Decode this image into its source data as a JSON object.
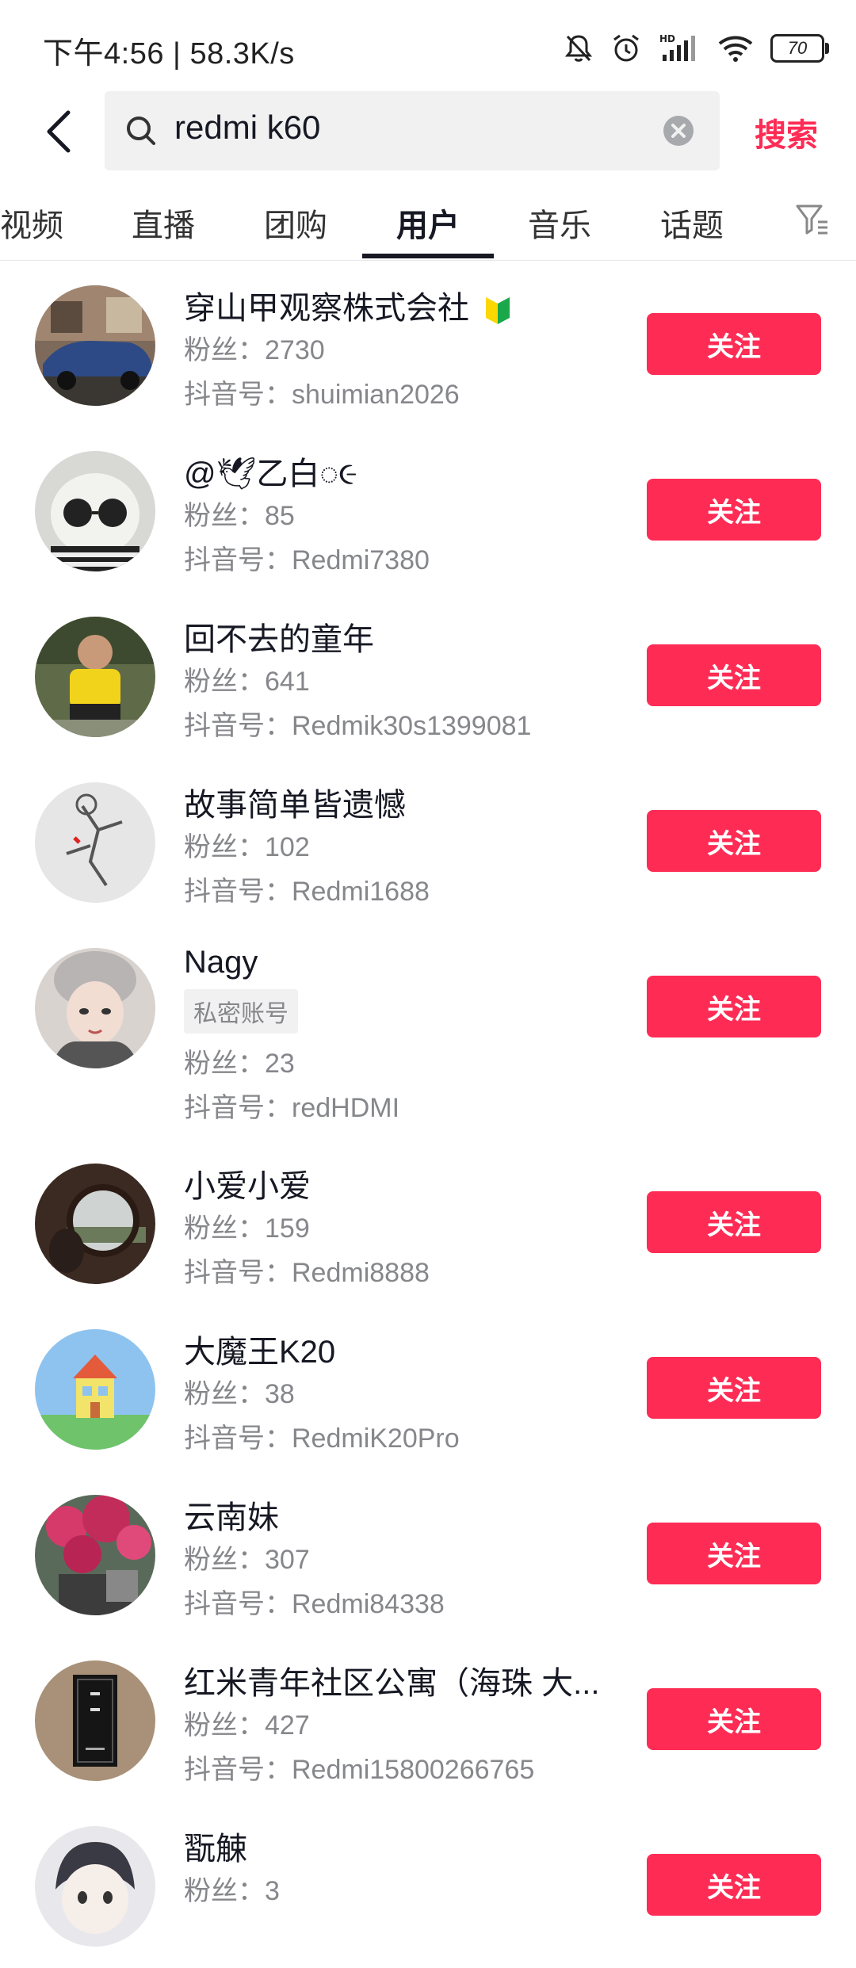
{
  "status_bar": {
    "time_speed": "下午4:56 | 58.3K/s",
    "battery": "70",
    "icons": [
      "mute-bell-icon",
      "alarm-icon",
      "hd-signal-icon",
      "wifi-icon",
      "battery-icon"
    ]
  },
  "search": {
    "query": "redmi k60",
    "submit_label": "搜索"
  },
  "tabs": [
    {
      "label": "视频"
    },
    {
      "label": "直播"
    },
    {
      "label": "团购"
    },
    {
      "label": "用户"
    },
    {
      "label": "音乐"
    },
    {
      "label": "话题"
    }
  ],
  "active_tab": "用户",
  "colors": {
    "accent": "#fe2c55",
    "text": "#161823",
    "secondary": "#86878b"
  },
  "users": [
    {
      "name": "穿山甲观察株式会社",
      "fans": "粉丝：2730",
      "douyin_id": "抖音号：shuimian2026",
      "follow": "关注"
    },
    {
      "name": "@🕊乙白◌૯",
      "fans": "粉丝：85",
      "douyin_id": "抖音号：Redmi7380",
      "follow": "关注"
    },
    {
      "name": "回不去的童年",
      "fans": "粉丝：641",
      "douyin_id": "抖音号：Redmik30s1399081",
      "follow": "关注"
    },
    {
      "name": "故事简单皆遗憾",
      "fans": "粉丝：102",
      "douyin_id": "抖音号：Redmi1688",
      "follow": "关注"
    },
    {
      "name": "Nagy",
      "tag": "私密账号",
      "fans": "粉丝：23",
      "douyin_id": "抖音号：redHDMI",
      "follow": "关注"
    },
    {
      "name": "小爱小爱",
      "fans": "粉丝：159",
      "douyin_id": "抖音号：Redmi8888",
      "follow": "关注"
    },
    {
      "name": "大魔王K20",
      "fans": "粉丝：38",
      "douyin_id": "抖音号：RedmiK20Pro",
      "follow": "关注"
    },
    {
      "name": "云南妹",
      "fans": "粉丝：307",
      "douyin_id": "抖音号：Redmi84338",
      "follow": "关注"
    },
    {
      "name": "红米青年社区公寓（海珠 大...",
      "fans": "粉丝：427",
      "douyin_id": "抖音号：Redmi15800266765",
      "follow": "关注"
    },
    {
      "name": "翫觫",
      "fans": "粉丝：3",
      "follow": "关注"
    }
  ]
}
